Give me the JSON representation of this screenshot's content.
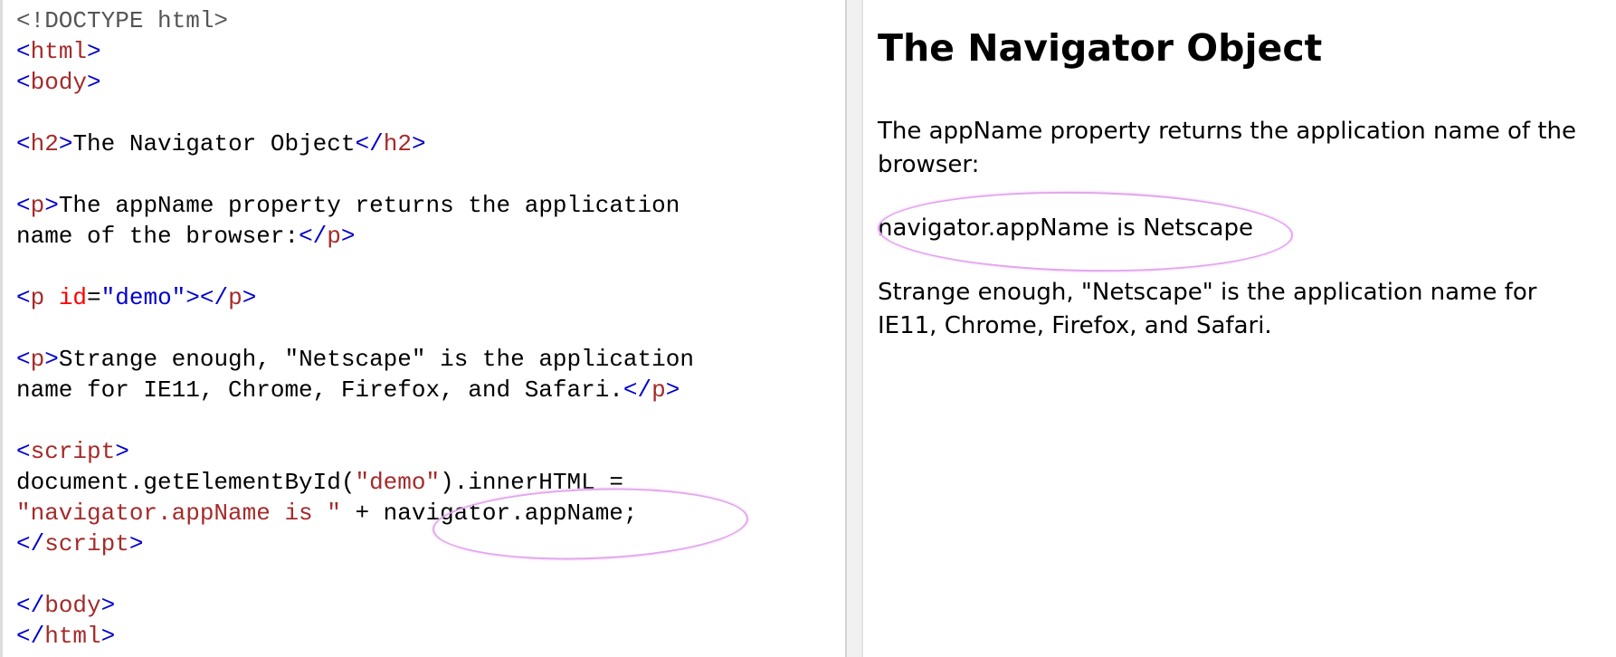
{
  "editor": {
    "lines": [
      [
        {
          "c": "g",
          "t": "<!DOCTYPE html>"
        }
      ],
      [
        {
          "c": "t",
          "t": "<"
        },
        {
          "c": "n",
          "t": "html"
        },
        {
          "c": "t",
          "t": ">"
        }
      ],
      [
        {
          "c": "t",
          "t": "<"
        },
        {
          "c": "n",
          "t": "body"
        },
        {
          "c": "t",
          "t": ">"
        }
      ],
      [],
      [
        {
          "c": "t",
          "t": "<"
        },
        {
          "c": "n",
          "t": "h2"
        },
        {
          "c": "t",
          "t": ">"
        },
        {
          "c": "k",
          "t": "The Navigator Object"
        },
        {
          "c": "t",
          "t": "</"
        },
        {
          "c": "n",
          "t": "h2"
        },
        {
          "c": "t",
          "t": ">"
        }
      ],
      [],
      [
        {
          "c": "t",
          "t": "<"
        },
        {
          "c": "n",
          "t": "p"
        },
        {
          "c": "t",
          "t": ">"
        },
        {
          "c": "k",
          "t": "The appName property returns the application"
        }
      ],
      [
        {
          "c": "k",
          "t": "name of the browser:"
        },
        {
          "c": "t",
          "t": "</"
        },
        {
          "c": "n",
          "t": "p"
        },
        {
          "c": "t",
          "t": ">"
        }
      ],
      [],
      [
        {
          "c": "t",
          "t": "<"
        },
        {
          "c": "n",
          "t": "p"
        },
        {
          "c": "k",
          "t": " "
        },
        {
          "c": "a",
          "t": "id"
        },
        {
          "c": "k",
          "t": "="
        },
        {
          "c": "v",
          "t": "\"demo\""
        },
        {
          "c": "t",
          "t": "></"
        },
        {
          "c": "n",
          "t": "p"
        },
        {
          "c": "t",
          "t": ">"
        }
      ],
      [],
      [
        {
          "c": "t",
          "t": "<"
        },
        {
          "c": "n",
          "t": "p"
        },
        {
          "c": "t",
          "t": ">"
        },
        {
          "c": "k",
          "t": "Strange enough, \"Netscape\" is the application"
        }
      ],
      [
        {
          "c": "k",
          "t": "name for IE11, Chrome, Firefox, and Safari."
        },
        {
          "c": "t",
          "t": "</"
        },
        {
          "c": "n",
          "t": "p"
        },
        {
          "c": "t",
          "t": ">"
        }
      ],
      [],
      [
        {
          "c": "t",
          "t": "<"
        },
        {
          "c": "n",
          "t": "script"
        },
        {
          "c": "t",
          "t": ">"
        }
      ],
      [
        {
          "c": "k",
          "t": "document.getElementById("
        },
        {
          "c": "s",
          "t": "\"demo\""
        },
        {
          "c": "k",
          "t": ").innerHTML ="
        }
      ],
      [
        {
          "c": "s",
          "t": "\"navigator.appName is \""
        },
        {
          "c": "k",
          "t": " + navigator.appName;"
        }
      ],
      [
        {
          "c": "t",
          "t": "</"
        },
        {
          "c": "n",
          "t": "script"
        },
        {
          "c": "t",
          "t": ">"
        }
      ],
      [],
      [
        {
          "c": "t",
          "t": "</"
        },
        {
          "c": "n",
          "t": "body"
        },
        {
          "c": "t",
          "t": ">"
        }
      ],
      [
        {
          "c": "t",
          "t": "</"
        },
        {
          "c": "n",
          "t": "html"
        },
        {
          "c": "t",
          "t": ">"
        }
      ]
    ]
  },
  "result": {
    "title": "The Navigator Object",
    "intro": "The appName property returns the application name of the browser:",
    "demo": "navigator.appName is Netscape",
    "note": "Strange enough, \"Netscape\" is the application name for IE11, Chrome, Firefox, and Safari."
  },
  "colors": {
    "tag_bracket": "#0000cd",
    "tag_name": "#a52a2a",
    "attr_name": "#ff0000",
    "attr_value": "#0000cd",
    "string": "#a52a2a",
    "doctype": "#555555",
    "highlight_oval": "#e2a6ee"
  }
}
